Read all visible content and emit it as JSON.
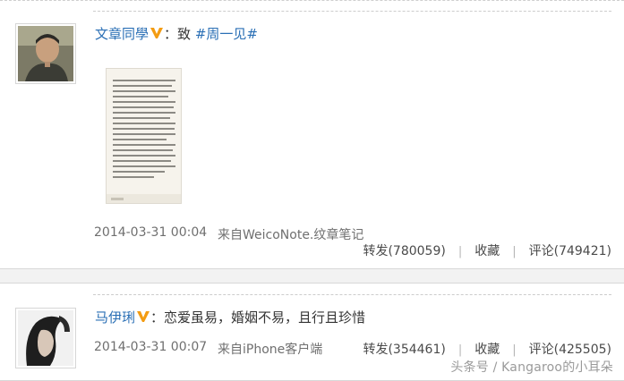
{
  "posts": [
    {
      "user": "文章同學",
      "separator": "：",
      "text": "致 ",
      "topic": "#周一见#",
      "time": "2014-03-31 00:04",
      "source": "来自WeicoNote.纹章笔记",
      "repost": "转发(780059)",
      "favorite": "收藏",
      "comment": "评论(749421)",
      "divider": "|"
    },
    {
      "user": "马伊琍",
      "separator": "：",
      "text": "恋爱虽易，婚姻不易，且行且珍惜",
      "time": "2014-03-31 00:07",
      "source": "来自iPhone客户端",
      "repost": "转发(354461)",
      "favorite": "收藏",
      "comment": "评论(425505)",
      "divider": "|"
    }
  ],
  "watermark": "头条号 / Kangaroo的小耳朵",
  "colors": {
    "link": "#2a6fb5",
    "meta": "#6f6f6f",
    "verified_badge": "#f39c12"
  }
}
